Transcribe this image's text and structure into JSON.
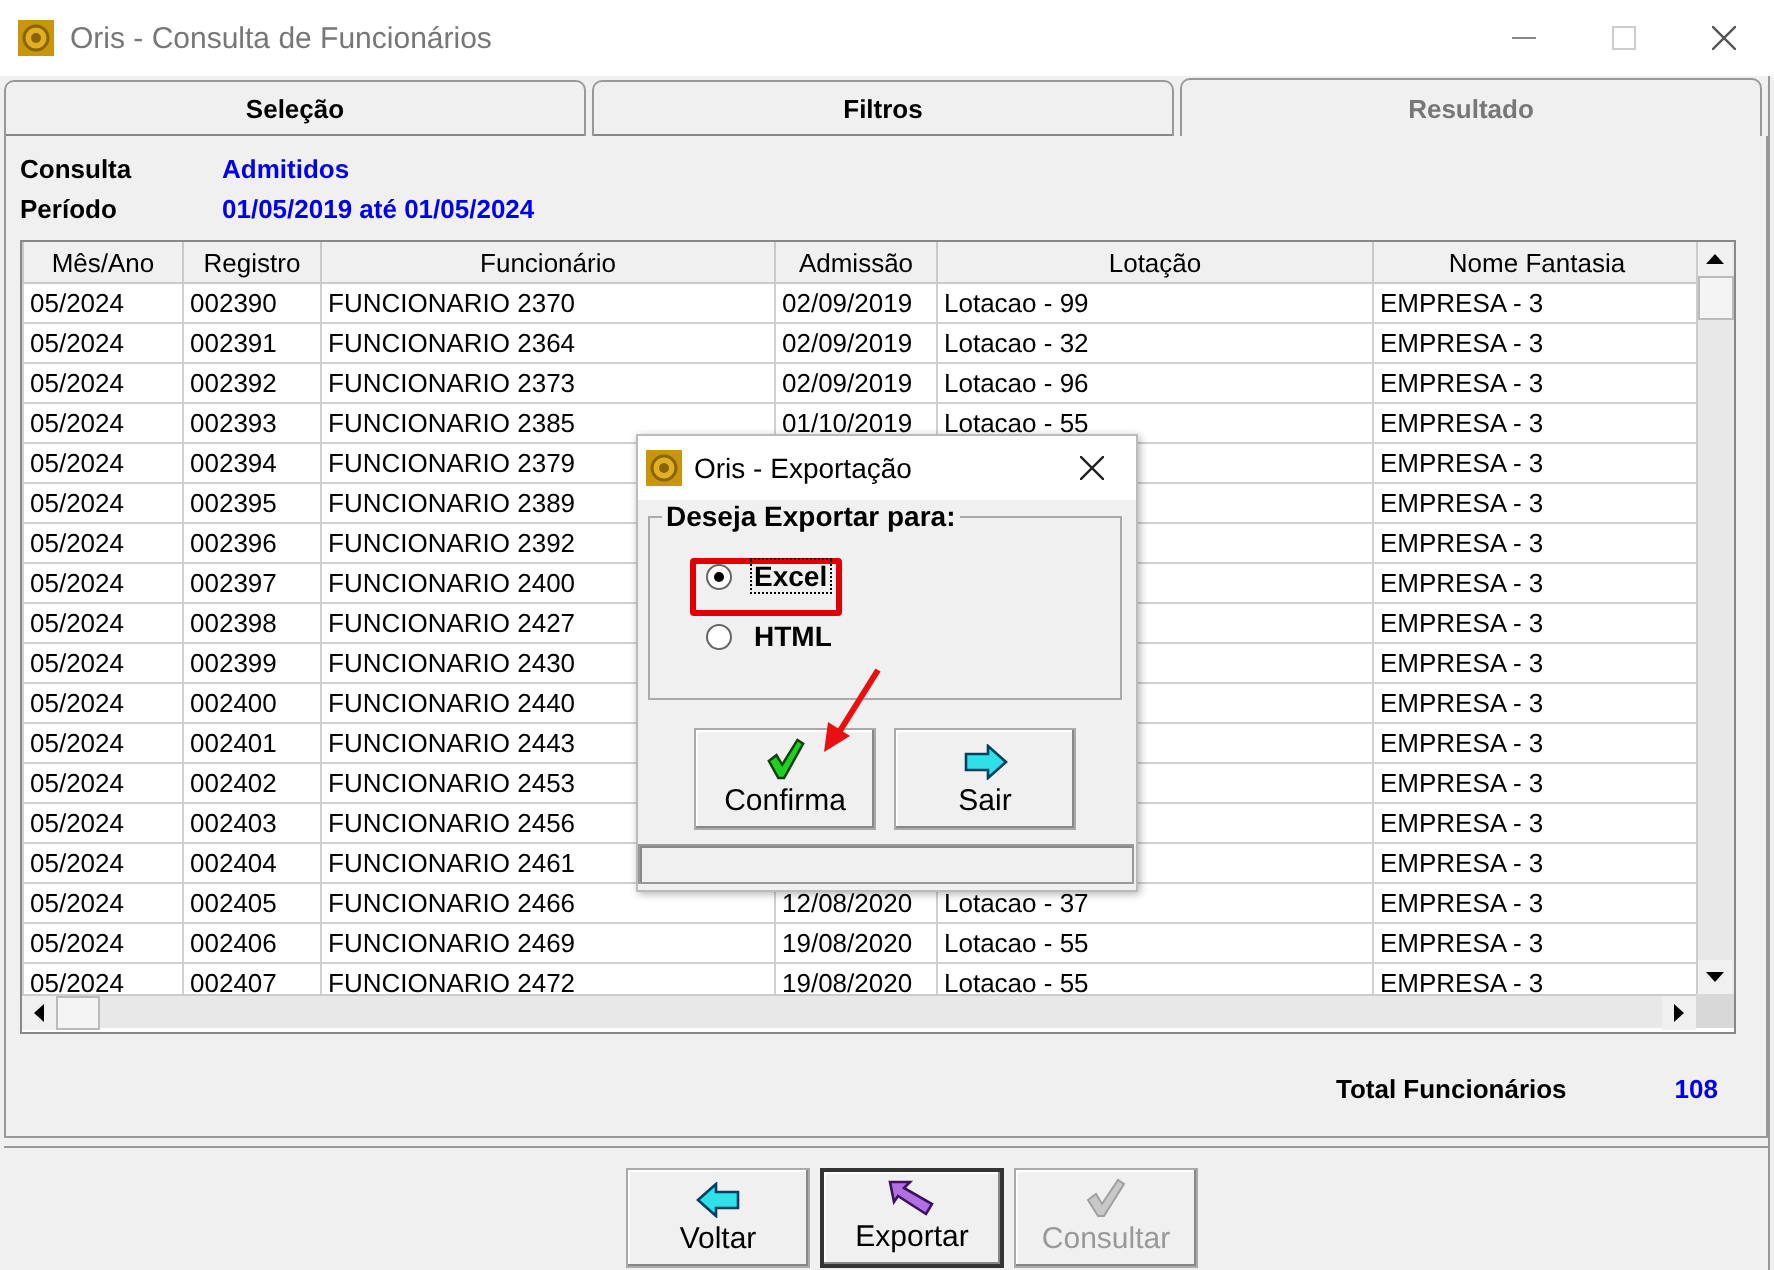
{
  "window": {
    "title": "Oris - Consulta de Funcionários"
  },
  "tabs": [
    {
      "label": "Seleção",
      "selected": false
    },
    {
      "label": "Filtros",
      "selected": false
    },
    {
      "label": "Resultado",
      "selected": true
    }
  ],
  "query": [
    {
      "label": "Consulta",
      "value": "Admitidos"
    },
    {
      "label": "Período",
      "value": "01/05/2019 até 01/05/2024"
    }
  ],
  "table": {
    "columns": [
      "Mês/Ano",
      "Registro",
      "Funcionário",
      "Admissão",
      "Lotação",
      "Nome Fantasia"
    ],
    "rows": [
      {
        "mes_ano": "05/2024",
        "registro": "002390",
        "funcionario": "FUNCIONARIO 2370",
        "admissao": "02/09/2019",
        "lotacao": "Lotacao - 99",
        "nome_fantasia": "EMPRESA - 3"
      },
      {
        "mes_ano": "05/2024",
        "registro": "002391",
        "funcionario": "FUNCIONARIO 2364",
        "admissao": "02/09/2019",
        "lotacao": "Lotacao - 32",
        "nome_fantasia": "EMPRESA - 3"
      },
      {
        "mes_ano": "05/2024",
        "registro": "002392",
        "funcionario": "FUNCIONARIO 2373",
        "admissao": "02/09/2019",
        "lotacao": "Lotacao - 96",
        "nome_fantasia": "EMPRESA - 3"
      },
      {
        "mes_ano": "05/2024",
        "registro": "002393",
        "funcionario": "FUNCIONARIO 2385",
        "admissao": "01/10/2019",
        "lotacao": "Lotacao - 55",
        "nome_fantasia": "EMPRESA - 3"
      },
      {
        "mes_ano": "05/2024",
        "registro": "002394",
        "funcionario": "FUNCIONARIO 2379",
        "nome_fantasia": "EMPRESA - 3"
      },
      {
        "mes_ano": "05/2024",
        "registro": "002395",
        "funcionario": "FUNCIONARIO 2389",
        "nome_fantasia": "EMPRESA - 3"
      },
      {
        "mes_ano": "05/2024",
        "registro": "002396",
        "funcionario": "FUNCIONARIO 2392",
        "nome_fantasia": "EMPRESA - 3"
      },
      {
        "mes_ano": "05/2024",
        "registro": "002397",
        "funcionario": "FUNCIONARIO 2400",
        "nome_fantasia": "EMPRESA - 3"
      },
      {
        "mes_ano": "05/2024",
        "registro": "002398",
        "funcionario": "FUNCIONARIO 2427",
        "nome_fantasia": "EMPRESA - 3"
      },
      {
        "mes_ano": "05/2024",
        "registro": "002399",
        "funcionario": "FUNCIONARIO 2430",
        "nome_fantasia": "EMPRESA - 3"
      },
      {
        "mes_ano": "05/2024",
        "registro": "002400",
        "funcionario": "FUNCIONARIO 2440",
        "nome_fantasia": "EMPRESA - 3"
      },
      {
        "mes_ano": "05/2024",
        "registro": "002401",
        "funcionario": "FUNCIONARIO 2443",
        "nome_fantasia": "EMPRESA - 3"
      },
      {
        "mes_ano": "05/2024",
        "registro": "002402",
        "funcionario": "FUNCIONARIO 2453",
        "nome_fantasia": "EMPRESA - 3"
      },
      {
        "mes_ano": "05/2024",
        "registro": "002403",
        "funcionario": "FUNCIONARIO 2456",
        "nome_fantasia": "EMPRESA - 3"
      },
      {
        "mes_ano": "05/2024",
        "registro": "002404",
        "funcionario": "FUNCIONARIO 2461",
        "nome_fantasia": "EMPRESA - 3"
      },
      {
        "mes_ano": "05/2024",
        "registro": "002405",
        "funcionario": "FUNCIONARIO 2466",
        "admissao": "12/08/2020",
        "lotacao": "Lotacao - 37",
        "nome_fantasia": "EMPRESA - 3"
      },
      {
        "mes_ano": "05/2024",
        "registro": "002406",
        "funcionario": "FUNCIONARIO 2469",
        "admissao": "19/08/2020",
        "lotacao": "Lotacao - 55",
        "nome_fantasia": "EMPRESA - 3"
      },
      {
        "mes_ano": "05/2024",
        "registro": "002407",
        "funcionario": "FUNCIONARIO 2472",
        "admissao": "19/08/2020",
        "lotacao": "Lotacao - 55",
        "nome_fantasia": "EMPRESA - 3"
      }
    ]
  },
  "total": {
    "label": "Total Funcionários",
    "value": "108"
  },
  "buttons": [
    {
      "label": "Voltar",
      "kind": "back",
      "default": false,
      "disabled": false
    },
    {
      "label": "Exportar",
      "kind": "export",
      "default": true,
      "disabled": false
    },
    {
      "label": "Consultar",
      "kind": "query",
      "default": false,
      "disabled": true
    }
  ],
  "dialog": {
    "title": "Oris - Exportação",
    "group_label": "Deseja Exportar para:",
    "options": [
      {
        "label": "Excel",
        "selected": true
      },
      {
        "label": "HTML",
        "selected": false
      }
    ],
    "buttons": [
      {
        "label": "Confirma",
        "kind": "confirm"
      },
      {
        "label": "Sair",
        "kind": "exit"
      }
    ]
  }
}
